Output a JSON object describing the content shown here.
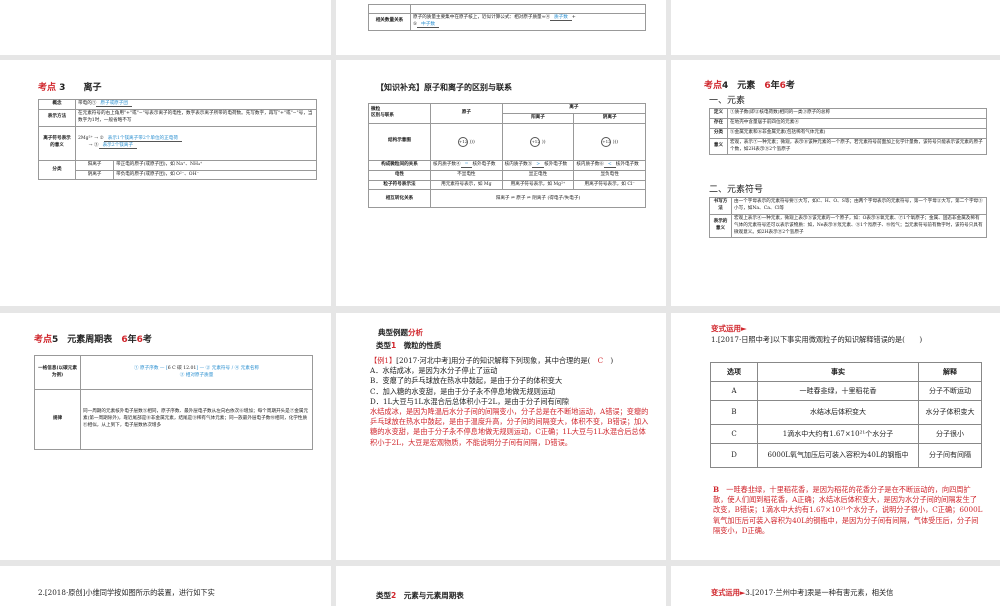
{
  "slide_top_mid": {
    "row_label": "相关数量关系",
    "text": "原子的质量主要集中在原子核上，近似计算公式：相对原子质量≈④",
    "a1": "质子数",
    "plus": "+",
    "n5": "⑤",
    "a2": "中子数"
  },
  "kp3": {
    "prefix": "考点",
    "num": "3",
    "title": "离子",
    "rows": [
      {
        "h": "概念",
        "text": "带电的①",
        "a": "原子或原子团"
      },
      {
        "h": "表示方法",
        "text": "在元素符号的右上角用\"+\"或\"−\"号表示离子的电性，数字表示离子所带的电荷数。先写数字，再写\"+\"或\"−\"号，当数字为1时，一般省略不写"
      },
      {
        "h": "离子符号表示的意义",
        "symbol": "2Mg²⁺",
        "n2": "②",
        "a2": "表示1个镁离子带2个单位的正电荷",
        "n3": "③",
        "a3": "表示2个镁离子"
      },
      {
        "h": "分类",
        "c1": "阳离子",
        "t1": "带正电的原子(或原子团)，如 Na⁺、NH₄⁺",
        "c2": "阴离子",
        "t2": "带负电的原子(或原子团)，如 O²⁻、OH⁻"
      }
    ]
  },
  "supp": {
    "title": "【知识补充】原子和离子的区别与联系",
    "diag1": "微粒",
    "diag2": "区别与联系",
    "atom": "原子",
    "ion": "离子",
    "cation": "阳离子",
    "anion": "阴离子",
    "r_struct": "结构示意图",
    "nuc": "+12",
    "r_rel": "构成微粒间的关系",
    "rel_atom": "核内质子数④",
    "rel_atom_a": "=",
    "rel_cat": "核内质子数⑤",
    "rel_cat_a": ">",
    "rel_an": "核内质子数⑥",
    "rel_an_a": "<",
    "rel_tail": "核外电子数",
    "r_charge": "电性",
    "ch_atom": "不显电性",
    "ch_cat": "显正电性",
    "ch_an": "显负电性",
    "r_sym": "粒子符号表示法",
    "sym_atom": "用元素符号表示，如 Mg",
    "sym_cat": "用离子符号表示，如 Mg²⁺",
    "sym_an": "用离子符号表示，如 Cl⁻",
    "r_conv": "相互转化关系",
    "conv": "阳离子 ⇌ 原子 ⇌ 阴离子",
    "conv_gain": "得电子",
    "conv_lose": "失电子"
  },
  "kp4": {
    "prefix": "考点",
    "num": "4",
    "title": "元素",
    "years": "6",
    "y1": "年",
    "y2": "6",
    "y3": "考",
    "sec1": "一、元素",
    "sec2": "二、元素符号",
    "t1": [
      {
        "h": "定义",
        "text": "①质子数(即②核电荷数)相同的一类③原子的总称",
        "a": [
          "质子",
          "核电荷数",
          "原子"
        ]
      },
      {
        "h": "存在",
        "text": "在地壳中含量居于前四位的元素④",
        "a": [
          "氧、硅、铝、铁"
        ]
      },
      {
        "h": "分类",
        "text": "⑤金属元素和⑥非金属元素(包括稀有气体元素)",
        "a": [
          "金属",
          "非金属"
        ]
      },
      {
        "h": "意义",
        "text": "宏观，表示⑦一种元素；微观，表示⑧该种元素的一个原子。若元素符号前面加上化学计量数，该符号只能表示该元素的原子个数，如2H表示⑨2个氢原子",
        "a": [
          "一种元素",
          "该种元素的一个原子",
          "2个氢原子"
        ]
      }
    ],
    "t2": [
      {
        "h": "书写方法",
        "text": "由一个字母表示的元素符号要①大写，如C、H、O、S等；由两个字母表示的元素符号，第一个字母②大写，第二个字母③小写，如Na、Ca、Cl等"
      },
      {
        "h": "表示的意义",
        "text": "宏观上表示④一种元素，微观上表示⑤该元素的一个原子，如：O表示⑥氧元素、⑦1个氧原子；金属、固态非金属及稀有气体的元素符号还可以表示该物质：如，Ne表示⑧氖元素、⑨1个氖原子、⑩氖气；当元素符号前有数字时，该符号只具有微观意义。如2H表示⑪2个氢原子"
      }
    ]
  },
  "kp5": {
    "prefix": "考点",
    "num": "5",
    "title": "元素周期表",
    "y0": "6",
    "y1": "年",
    "y2": "6",
    "y3": "考",
    "r1h": "一格信息(以碳元素为例)",
    "cell": {
      "num": "6",
      "sym": "C",
      "name": "碳",
      "mass": "12.01"
    },
    "labels": [
      "① 原子序数",
      "② 元素符号",
      "④ 元素名称",
      "③ 相对原子质量"
    ],
    "r2h": "规律",
    "r2": "同一周期的元素核外电子层数⑤相同，原子序数、最外层电子数从左向右依次⑥增加；每个周期开头是⑦金属元素(第一周期除外)，靠近尾部是⑧非金属元素，结尾是⑨稀有气体元素；同一族最外层电子数⑩相同，化学性质⑪相似，从上到下，电子层数依次增多"
  },
  "ex": {
    "head1": "典型例题",
    "head2": "分析",
    "type_label": "类型",
    "type_num": "1",
    "type_title": "微粒的性质",
    "tag": "【例1】",
    "q": "[2017·河北中考]用分子的知识解释下列现象，其中合理的是(",
    "ans": "C",
    "q_end": ")",
    "opts": [
      "A．水结成冰，是因为水分子停止了运动",
      "B．变瘪了的乒乓球放在热水中鼓起，是由于分子的体积变大",
      "C．加入糖的水变甜，是由于分子永不停息地做无规则运动",
      "D．1L大豆与1L水混合后总体积小于2L，是由于分子间有间隙"
    ],
    "expl": "水结成冰，是因为降温后水分子间的间隔变小，分子总是在不断地运动，A错误；变瘪的乒乓球放在热水中鼓起，是由于温度升高，分子间的间隔变大，体积不变，B错误；加入糖的水变甜，是由于分子永不停息地做无规则运动，C正确；1L大豆与1L水混合后总体积小于2L，大豆是宏观物质，不能说明分子间有间隔，D错误。"
  },
  "var1": {
    "head": "变式运用►",
    "q": "1.[2017·日照中考]以下事实用微观粒子的知识解释错误的是(　　)",
    "cols": [
      "选项",
      "事实",
      "解释"
    ],
    "rows": [
      [
        "A",
        "一畦春韭绿，十里稻花香",
        "分子不断运动"
      ],
      [
        "B",
        "水结冰后体积变大",
        "水分子体积变大"
      ],
      [
        "C",
        "1滴水中大约有1.67×10²¹个水分子",
        "分子很小"
      ],
      [
        "D",
        "6000L氧气加压后可装入容积为40L的钢瓶中",
        "分子间有间隔"
      ]
    ],
    "ans": "B",
    "expl": "一畦春韭绿，十里稻花香，是因为稻花的花香分子是在不断运动的，向四周扩散，使人们闻到稻花香，A正确；水结冰后体积变大，是因为水分子间的间隔发生了改变，B错误；1滴水中大约有1.67×10²¹个水分子，说明分子很小，C正确；6000L氧气加压后可装入容积为40L的钢瓶中，是因为分子间有间隔，气体受压后，分子间隔变小，D正确。"
  },
  "bottom": {
    "q2": "2.[2018·原创]小维同学按如图所示的装置，进行如下实",
    "type_label": "类型",
    "type_num": "2",
    "type_title": "元素与元素周期表",
    "var_head": "变式运用►",
    "q3": "3.[2017·兰州中考]汞是一种有害元素，相关信"
  }
}
